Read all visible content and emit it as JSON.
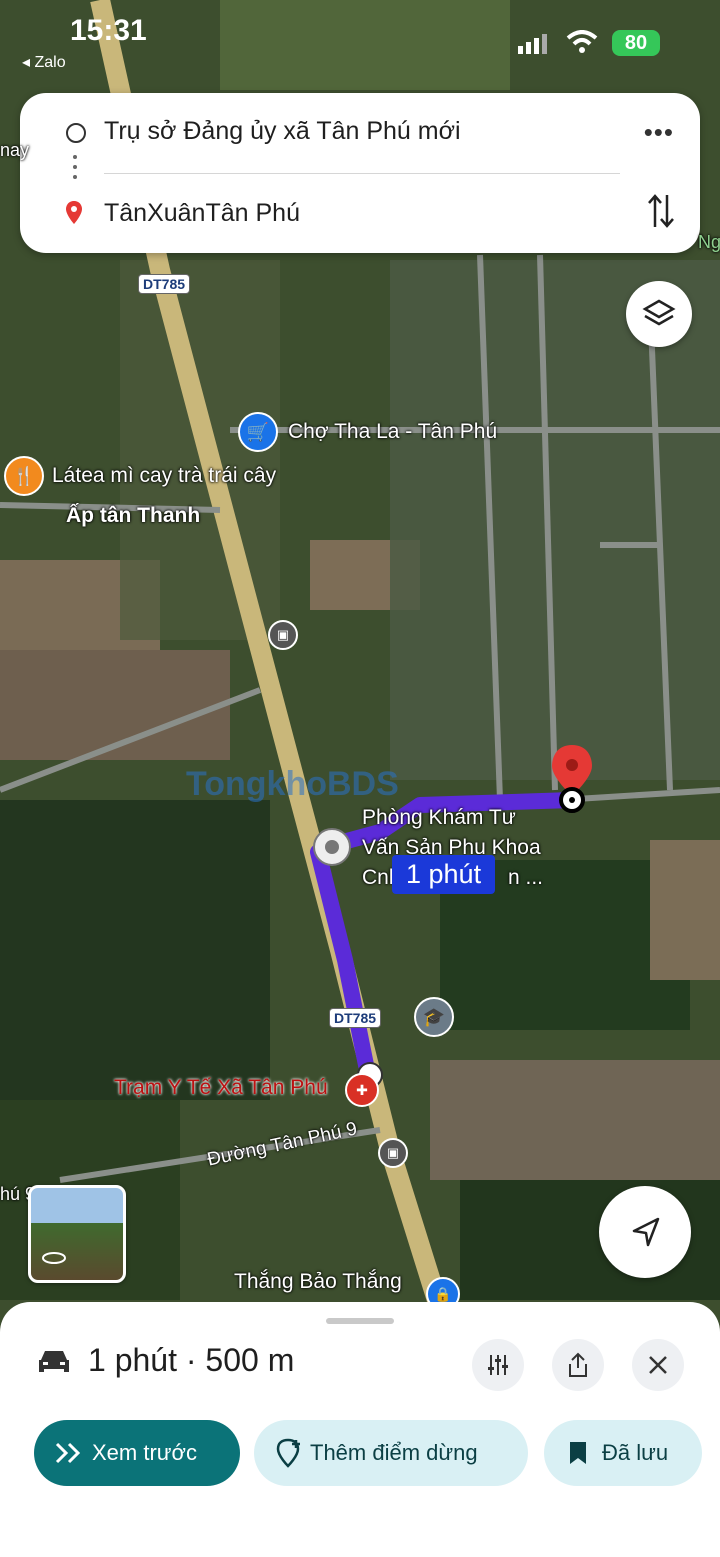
{
  "status_bar": {
    "time": "15:31",
    "back_app": "◂ Zalo",
    "battery": "80"
  },
  "directions": {
    "origin": "Trụ sở Đảng ủy xã Tân Phú mới",
    "destination": "TânXuânTân Phú"
  },
  "map": {
    "road_shields": [
      "DT785",
      "DT785"
    ],
    "labels": {
      "market": "Chợ Tha La - Tân Phú",
      "restaurant": "Látea mì cay trà trái cây",
      "hamlet": "Ấp tân Thanh",
      "clinic_line1": "Phòng Khám Tư",
      "clinic_line2": "Vấn Sản Phụ Khoa",
      "clinic_line3": "Cnl",
      "clinic_line3_end": "n ...",
      "health_station": "Trạm Y Tế Xã Tân Phú",
      "street": "Đường Tân Phú 9",
      "shop": "Thắng Bảo Thắng",
      "edge_left": "nay",
      "edge_right": "Ng",
      "edge_bottom_left": "hú 9"
    },
    "watermark": "TongkhoBDS",
    "route_duration": "1 phút",
    "route_color": "#5b2bd8"
  },
  "bottom_sheet": {
    "summary": "1 phút · 500 m",
    "preview_label": "Xem trước",
    "add_stop_label": "Thêm điểm dừng",
    "saved_label": "Đã lưu",
    "accent": "#0b7378"
  }
}
